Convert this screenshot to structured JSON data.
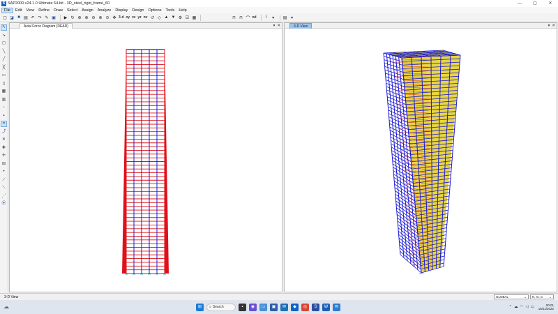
{
  "window": {
    "app_icon": "S",
    "title": "SAP2000 v24.1.0 Ultimate 64-bit - 3D_steel_rigid_frame_60",
    "minimize": "—",
    "maximize": "▢",
    "close": "✕"
  },
  "menu": {
    "items": [
      "File",
      "Edit",
      "View",
      "Define",
      "Draw",
      "Select",
      "Assign",
      "Analyze",
      "Display",
      "Design",
      "Options",
      "Tools",
      "Help"
    ]
  },
  "toolbar": {
    "view_3d": "3-d",
    "view_xy": "xy",
    "view_xz": "xz",
    "view_yz": "yz",
    "view_nv": "nv",
    "view_nd": "nd"
  },
  "panes": {
    "left": {
      "tab": "Axial Force Diagram (DEAD)",
      "dropdown": "▾",
      "close": "✕"
    },
    "right": {
      "tab": "3-D View",
      "dropdown": "▾",
      "close": "✕"
    }
  },
  "colors": {
    "frame_blue": "#1a1ad6",
    "force_red": "#e0101a",
    "shell_yellow": "#e8d640",
    "support_cyan": "#33ccdd"
  },
  "status": {
    "text": "3-D View",
    "coord_system": "GLOBAL",
    "units": "N, m, C"
  },
  "taskbar": {
    "search": "Search",
    "time": "00:01",
    "date": "18/11/2022"
  }
}
